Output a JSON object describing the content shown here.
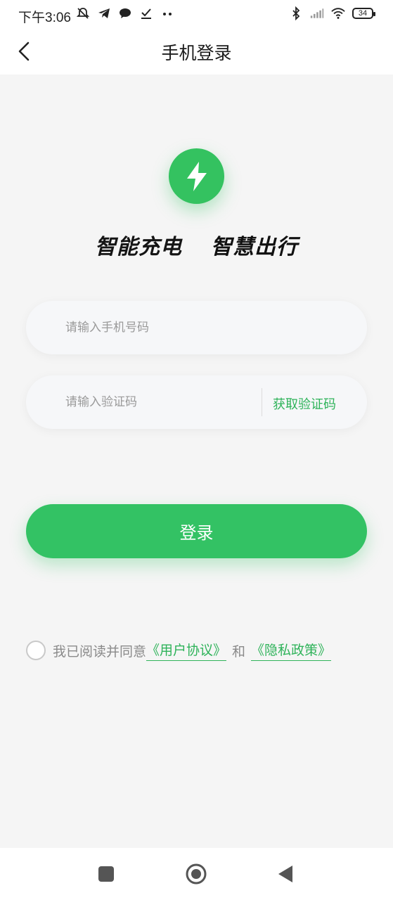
{
  "status_bar": {
    "time": "下午3:06",
    "battery": "34",
    "icons": [
      "mute-icon",
      "telegram-icon",
      "chat-icon",
      "check-icon",
      "more-dots-icon",
      "bluetooth-icon",
      "signal-icon",
      "wifi-icon",
      "battery-icon"
    ]
  },
  "header": {
    "title": "手机登录",
    "back_icon": "chevron-left-icon"
  },
  "logo": {
    "icon": "lightning-icon",
    "color": "#34c260"
  },
  "slogan": {
    "part1": "智能充电",
    "part2": "智慧出行"
  },
  "form": {
    "phone_placeholder": "请输入手机号码",
    "phone_value": "",
    "code_placeholder": "请输入验证码",
    "code_value": "",
    "get_code_label": "获取验证码"
  },
  "login_button": {
    "label": "登录"
  },
  "agreement": {
    "prefix": "我已阅读并同意",
    "user_agreement": "《用户协议》",
    "and": "和",
    "privacy_policy": "《隐私政策》"
  },
  "colors": {
    "accent": "#33c264",
    "link": "#2fb35a",
    "background": "#f5f5f5"
  }
}
